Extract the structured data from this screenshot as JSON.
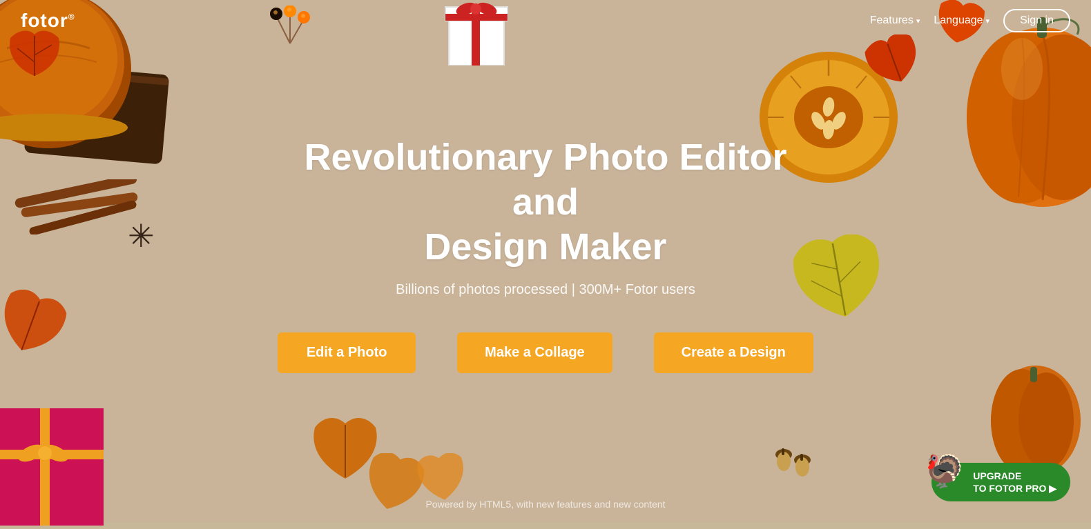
{
  "logo": {
    "text": "fotor",
    "sup": "®"
  },
  "nav": {
    "features_label": "Features",
    "language_label": "Language",
    "signin_label": "Sign in"
  },
  "hero": {
    "title_line1": "Revolutionary Photo Editor and",
    "title_line2": "Design Maker",
    "subtitle": "Billions of photos processed | 300M+ Fotor users",
    "btn_edit": "Edit a Photo",
    "btn_collage": "Make a Collage",
    "btn_design": "Create a Design"
  },
  "footer_text": "Powered by HTML5, with new features and new content",
  "upgrade": {
    "line1": "UPGRADE",
    "line2": "TO FOTOR PRO ▶"
  },
  "colors": {
    "bg": "#c9b49a",
    "cta_orange": "#f5a623",
    "upgrade_green": "#2a8a2a",
    "nav_text": "#ffffff"
  }
}
